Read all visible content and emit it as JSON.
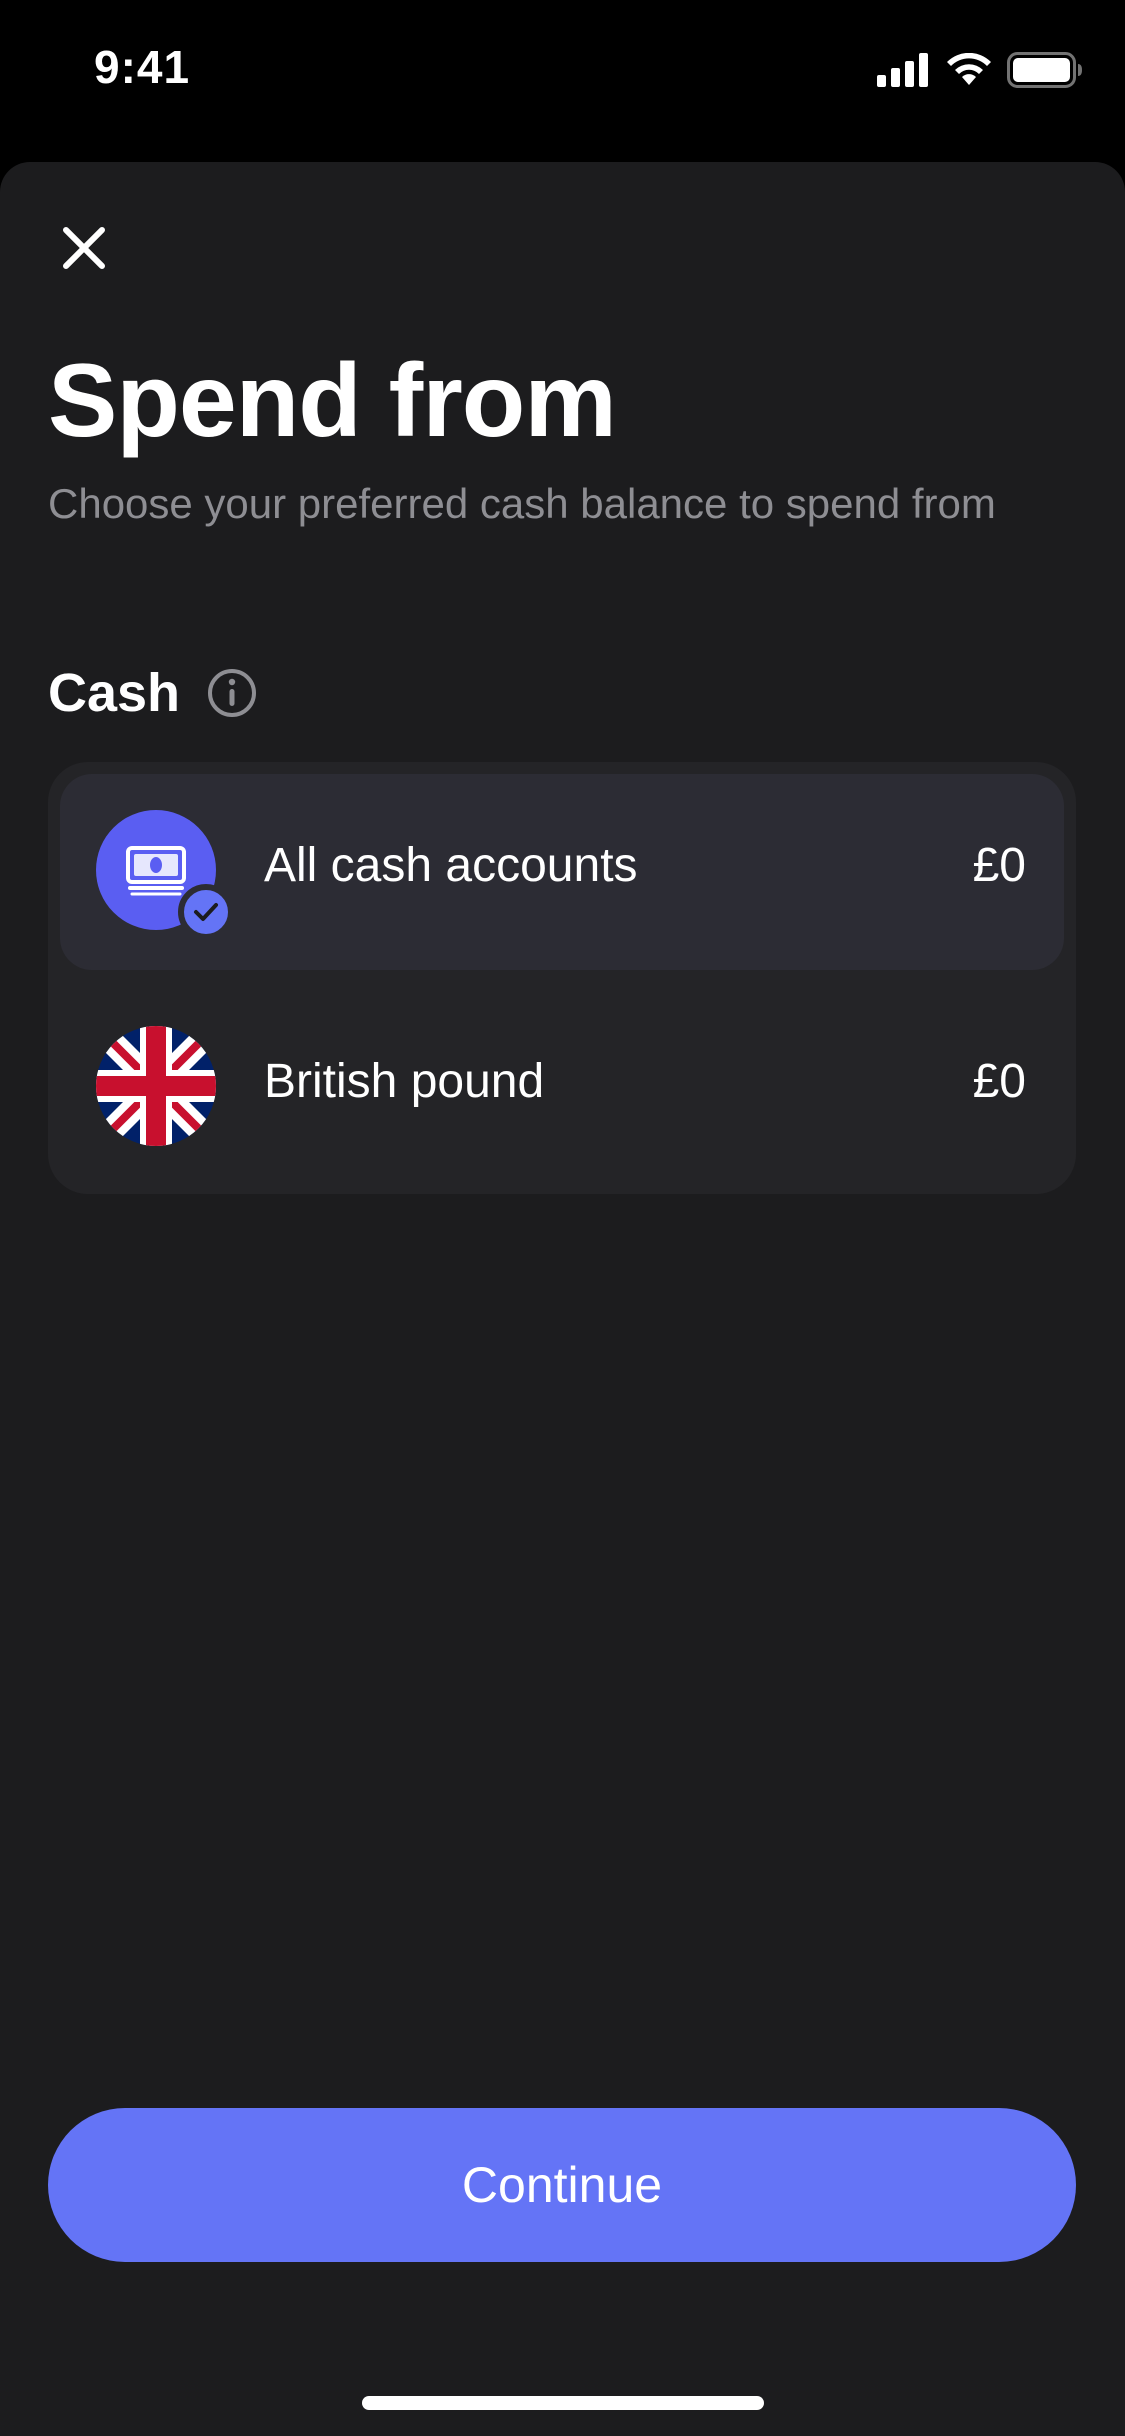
{
  "status_bar": {
    "time": "9:41",
    "icons": [
      "cellular-signal-icon",
      "wifi-icon",
      "battery-icon"
    ]
  },
  "sheet": {
    "close_icon": "close-icon",
    "title": "Spend from",
    "subtitle": "Choose your preferred cash balance to spend from"
  },
  "section": {
    "label": "Cash",
    "info_icon": "info-icon"
  },
  "options": [
    {
      "label": "All cash accounts",
      "value": "£0",
      "icon": "cash-stack-icon",
      "selected": true
    },
    {
      "label": "British pound",
      "value": "£0",
      "icon": "uk-flag-icon",
      "selected": false
    }
  ],
  "footer": {
    "continue_label": "Continue"
  },
  "colors": {
    "background": "#1c1c1e",
    "card": "#242427",
    "selected_row": "#2c2c34",
    "accent": "#6474f6",
    "subtitle": "#8e8e93"
  }
}
